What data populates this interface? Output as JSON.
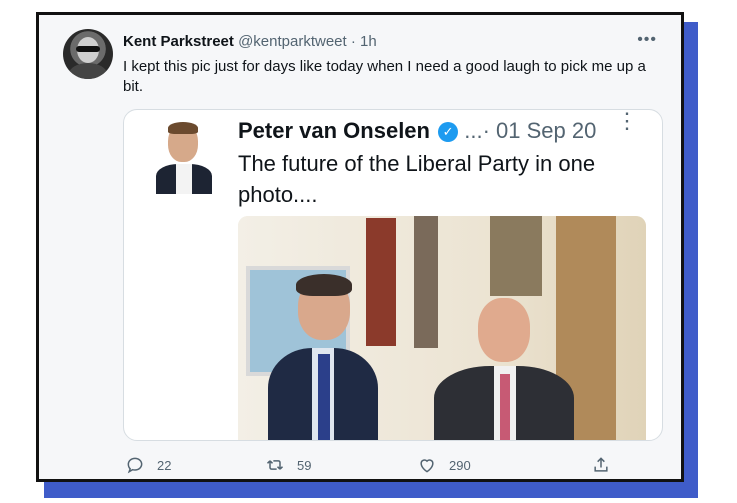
{
  "tweet": {
    "display_name": "Kent Parkstreet",
    "handle": "@kentparktweet",
    "separator": "·",
    "time": "1h",
    "text": "I kept this pic just for days like today when I need a good laugh to pick me up a bit.",
    "more_icon": "more-horizontal-icon"
  },
  "quoted_tweet": {
    "display_name": "Peter van Onselen",
    "verified_icon": "verified-badge-icon",
    "ellipsis": "...",
    "separator": "·",
    "date": "01 Sep 20",
    "text": "The future of the Liberal Party in one photo....",
    "more_icon": "more-vertical-icon"
  },
  "actions": {
    "reply_count": "22",
    "retweet_count": "59",
    "like_count": "290"
  },
  "colors": {
    "shadow": "#3f5cc9",
    "border": "#111111",
    "verified": "#1d9bf0",
    "muted": "#536471"
  }
}
